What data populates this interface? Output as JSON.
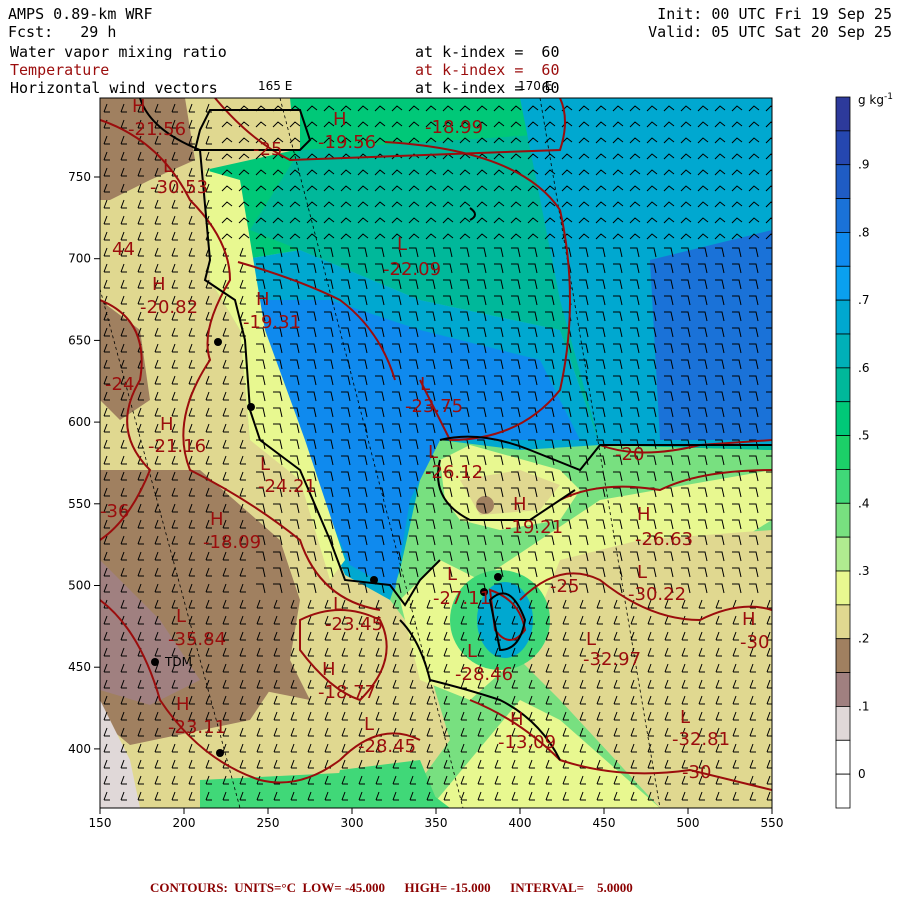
{
  "header": {
    "title": "AMPS 0.89-km WRF",
    "forecast": "Fcst:   29 h",
    "init": "Init: 00 UTC Fri 19 Sep 25",
    "valid": "Valid: 05 UTC Sat 20 Sep 25",
    "fields": [
      {
        "name": "Water vapor mixing ratio",
        "level": "at k-index =  60"
      },
      {
        "name": "Temperature",
        "level": "at k-index =  60"
      },
      {
        "name": "Horizontal wind vectors",
        "level": "at k-index =  60"
      }
    ]
  },
  "map": {
    "longitude_labels": [
      "165 E",
      "170 E"
    ],
    "x_ticks": [
      "150",
      "200",
      "250",
      "300",
      "350",
      "400",
      "450",
      "500",
      "550"
    ],
    "y_ticks": [
      "750",
      "700",
      "650",
      "600",
      "550",
      "500",
      "450",
      "400"
    ],
    "centers": [
      {
        "type": "H",
        "value": "-21.56"
      },
      {
        "type": "L",
        "value": "-30.53"
      },
      {
        "type": "H",
        "value": "-19.56"
      },
      {
        "type": "",
        "value": "-18.99"
      },
      {
        "type": "L",
        "value": "-22.09"
      },
      {
        "type": "H",
        "value": "-20.82"
      },
      {
        "type": "H",
        "value": "-19.31"
      },
      {
        "type": "L",
        "value": "-23.75"
      },
      {
        "type": "H",
        "value": "-21.16"
      },
      {
        "type": "L",
        "value": "-24.21"
      },
      {
        "type": "H",
        "value": "-18.09"
      },
      {
        "type": "L",
        "value": "-26.12"
      },
      {
        "type": "H",
        "value": "-19.21"
      },
      {
        "type": "H",
        "value": "-26.63"
      },
      {
        "type": "L",
        "value": "-23.45"
      },
      {
        "type": "L",
        "value": "-35.84"
      },
      {
        "type": "L",
        "value": "-27.11"
      },
      {
        "type": "L",
        "value": "-30.22"
      },
      {
        "type": "L",
        "value": "-32.97"
      },
      {
        "type": "H",
        "value": "-30"
      },
      {
        "type": "H",
        "value": "-18.77"
      },
      {
        "type": "L",
        "value": "-28.46"
      },
      {
        "type": "H",
        "value": "-23.11"
      },
      {
        "type": "L",
        "value": "-28.45"
      },
      {
        "type": "H",
        "value": "-13.09"
      },
      {
        "type": "L",
        "value": "-32.81"
      }
    ],
    "contour_labels": [
      "-25",
      "44",
      "-24",
      "-36",
      "-25",
      "-20",
      "-30"
    ],
    "station_label": "TDM"
  },
  "colorbar": {
    "units": "g kg",
    "units_exp": "-1",
    "labels": [
      "0",
      ".1",
      ".2",
      ".3",
      ".4",
      ".5",
      ".6",
      ".7",
      ".8",
      ".9"
    ],
    "colors": [
      "#2d3a9b",
      "#2547b0",
      "#1f5cc4",
      "#1a72d8",
      "#0f8aee",
      "#0aa0ef",
      "#00a8d0",
      "#00b0b8",
      "#00b89a",
      "#00c878",
      "#1cd068",
      "#40d878",
      "#78e080",
      "#b0ec90",
      "#e8f890",
      "#e0d890",
      "#a08060",
      "#a08080",
      "#e0d8d8",
      "#ffffff",
      "#ffffff"
    ]
  },
  "footer": {
    "text": "CONTOURS:  UNITS=°C  LOW= -45.000      HIGH= -15.000      INTERVAL=    5.0000"
  },
  "colors": {
    "contour": "#9b0d0d",
    "coast": "#000000"
  }
}
